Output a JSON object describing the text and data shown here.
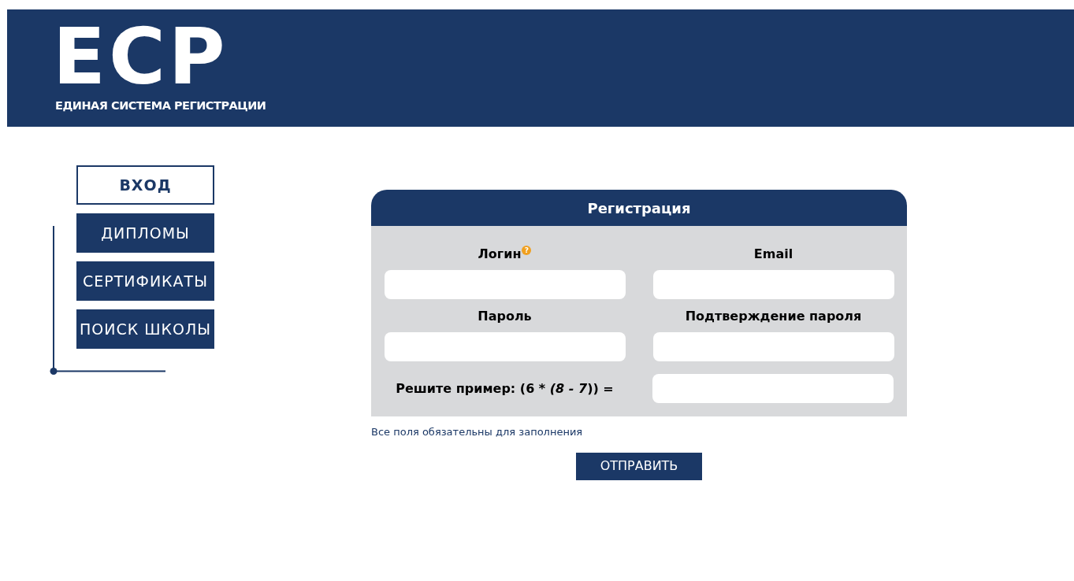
{
  "header": {
    "logo": {
      "letters": "ЕСР",
      "tagline": "ЕДИНАЯ СИСТЕМА РЕГИСТРАЦИИ"
    }
  },
  "nav": [
    {
      "label": "ВХОД",
      "selected": true
    },
    {
      "label": "ДИПЛОМЫ",
      "selected": false
    },
    {
      "label": "СЕРТИФИКАТЫ",
      "selected": false
    },
    {
      "label": "ПОИСК ШКОЛЫ",
      "selected": false
    }
  ],
  "form": {
    "title": "Регистрация",
    "fields": [
      {
        "label": "Логин",
        "help": "?"
      },
      {
        "label": "Email"
      },
      {
        "label": "Пароль"
      },
      {
        "label": "Подтверждение пароля"
      }
    ],
    "captcha": {
      "parts": [
        {
          "text": "Решите пример: (6 * ",
          "italic": false
        },
        {
          "text": "(8 - 7",
          "italic": true
        },
        {
          "text": ")) =",
          "italic": false
        }
      ]
    },
    "note": "Все поля обязательны для заполнения",
    "submit": "ОТПРАВИТЬ"
  }
}
